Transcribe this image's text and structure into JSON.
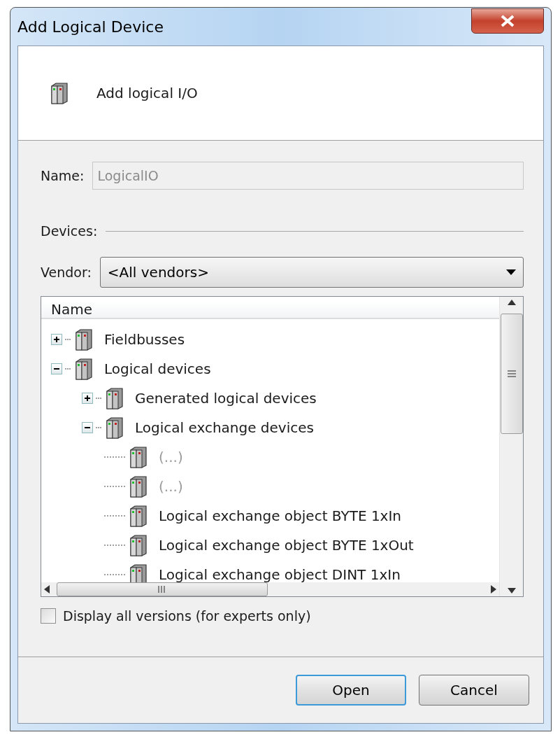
{
  "window": {
    "title": "Add Logical Device"
  },
  "header": {
    "title": "Add logical I/O"
  },
  "name_field": {
    "label": "Name:",
    "value": "LogicalIO",
    "disabled": true
  },
  "devices_section": {
    "label": "Devices:"
  },
  "vendor": {
    "label": "Vendor:",
    "value": "<All vendors>"
  },
  "tree": {
    "column": "Name",
    "items": [
      {
        "label": "Fieldbusses",
        "expanded": false
      },
      {
        "label": "Logical devices",
        "expanded": true,
        "children": [
          {
            "label": "Generated logical devices",
            "expanded": false
          },
          {
            "label": "Logical exchange devices",
            "expanded": true,
            "children": [
              {
                "label": "(...)",
                "disabled": true
              },
              {
                "label": "(...)",
                "disabled": true
              },
              {
                "label": "Logical exchange object BYTE 1xIn",
                "disabled": false
              },
              {
                "label": "Logical exchange object BYTE 1xOut",
                "disabled": false
              },
              {
                "label": "Logical exchange object DINT 1xIn",
                "disabled": false
              }
            ]
          }
        ]
      }
    ]
  },
  "show_all_versions": {
    "label": "Display all versions (for experts only)",
    "checked": false
  },
  "buttons": [
    {
      "label": "Open",
      "default": true
    },
    {
      "label": "Cancel",
      "default": false
    }
  ]
}
